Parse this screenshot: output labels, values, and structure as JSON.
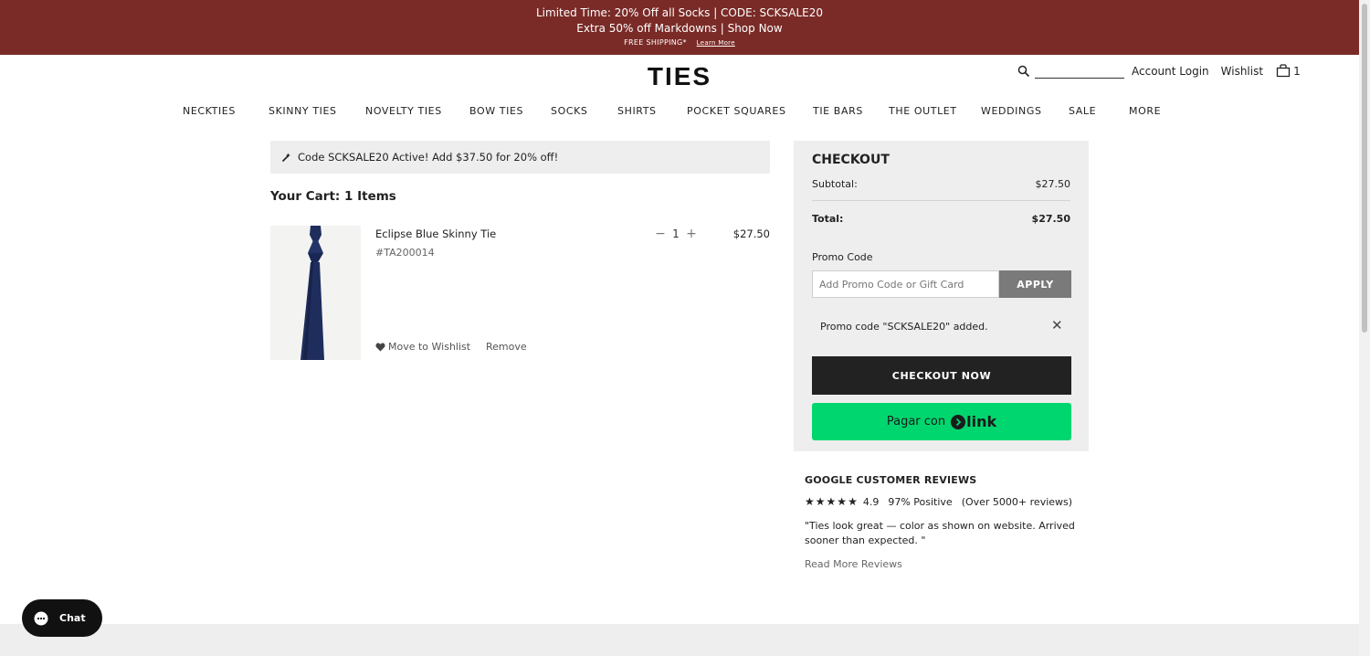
{
  "promo_bar": {
    "line1": "Limited Time: 20% Off all Socks | CODE: SCKSALE20",
    "line2": "Extra 50% off Markdowns | Shop Now",
    "line3": "FREE SHIPPING*",
    "learn_more": "Learn More",
    "background": "#7a2b27"
  },
  "header": {
    "logo": "TIES",
    "account_login": "Account Login",
    "wishlist": "Wishlist",
    "cart_count": "1",
    "icons": [
      "search-icon",
      "cart-icon"
    ]
  },
  "nav": {
    "items": [
      "NECKTIES",
      "SKINNY TIES",
      "NOVELTY TIES",
      "BOW TIES",
      "SOCKS",
      "SHIRTS",
      "POCKET SQUARES",
      "TIE BARS",
      "THE OUTLET",
      "WEDDINGS",
      "SALE",
      "MORE"
    ]
  },
  "cart": {
    "code_banner": "Code SCKSALE20 Active! Add $37.50 for 20% off!",
    "title": "Your Cart: 1 Items",
    "item": {
      "name": "Eclipse Blue Skinny Tie",
      "sku": "#TA200014",
      "quantity": "1",
      "price": "$27.50",
      "move_to_wishlist": "Move to Wishlist",
      "remove": "Remove",
      "tie_color": "#1e2d5c"
    }
  },
  "checkout": {
    "title": "CHECKOUT",
    "subtotal_label": "Subtotal:",
    "subtotal_value": "$27.50",
    "total_label": "Total:",
    "total_value": "$27.50",
    "promo_label": "Promo Code",
    "promo_placeholder": "Add Promo Code or Gift Card",
    "apply_label": "APPLY",
    "promo_added": "Promo code \"SCKSALE20\" added.",
    "close_glyph": "✕",
    "checkout_now": "CHECKOUT NOW",
    "link_pay_text": "Pagar con",
    "link_word": "link",
    "link_color": "#00d66f"
  },
  "reviews": {
    "title": "GOOGLE CUSTOMER REVIEWS",
    "stars": 5,
    "rating": "4.9",
    "positive": "97% Positive",
    "count": "(Over 5000+ reviews)",
    "quote": "\"Ties look great — color as shown on website. Arrived sooner than expected. \"",
    "read_more": "Read More Reviews"
  },
  "chat": {
    "label": "Chat"
  }
}
